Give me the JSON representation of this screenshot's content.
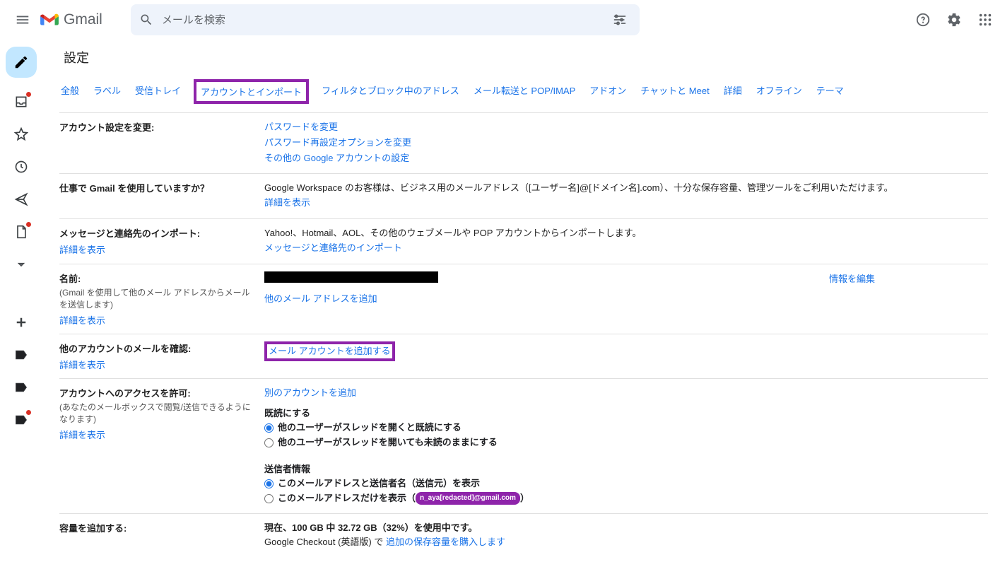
{
  "header": {
    "product": "Gmail",
    "search_placeholder": "メールを検索"
  },
  "page": {
    "title": "設定"
  },
  "tabs": [
    "全般",
    "ラベル",
    "受信トレイ",
    "アカウントとインポート",
    "フィルタとブロック中のアドレス",
    "メール転送と POP/IMAP",
    "アドオン",
    "チャットと Meet",
    "詳細",
    "オフライン",
    "テーマ"
  ],
  "sec_account": {
    "label": "アカウント設定を変更:",
    "links": [
      "パスワードを変更",
      "パスワード再設定オプションを変更",
      "その他の Google アカウントの設定"
    ]
  },
  "sec_workspace": {
    "label": "仕事で Gmail を使用していますか？",
    "text": "Google Workspace のお客様は、ビジネス用のメールアドレス（[ユーザー名]@[ドメイン名].com）、十分な保存容量、管理ツールをご利用いただけます。",
    "more": "詳細を表示"
  },
  "sec_import": {
    "label": "メッセージと連絡先のインポート:",
    "more": "詳細を表示",
    "text": "Yahoo!、Hotmail、AOL、その他のウェブメールや POP アカウントからインポートします。",
    "link": "メッセージと連絡先のインポート"
  },
  "sec_name": {
    "label": "名前:",
    "sub": "(Gmail を使用して他のメール アドレスからメールを送信します)",
    "more": "詳細を表示",
    "add": "他のメール アドレスを追加",
    "edit": "情報を編集"
  },
  "sec_check": {
    "label": "他のアカウントのメールを確認:",
    "more": "詳細を表示",
    "add": "メール アカウントを追加する"
  },
  "sec_access": {
    "label": "アカウントへのアクセスを許可:",
    "sub": "(あなたのメールボックスで閲覧/送信できるようになります)",
    "more": "詳細を表示",
    "add": "別のアカウントを追加",
    "grp1_title": "既読にする",
    "grp1_opt1": "他のユーザーがスレッドを開くと既読にする",
    "grp1_opt2": "他のユーザーがスレッドを開いても未読のままにする",
    "grp2_title": "送信者情報",
    "grp2_opt1": "このメールアドレスと送信者名（送信元）を表示",
    "grp2_opt2": "このメールアドレスだけを表示（",
    "grp2_opt2_redacted_pill": "n_aya[redacted]@gmail.com",
    "grp2_opt2_end": "）"
  },
  "sec_storage": {
    "label": "容量を追加する:",
    "line1": "現在、100 GB 中 32.72 GB（32%）を使用中です。",
    "line2a": "Google Checkout (英語版) で ",
    "line2b": "追加の保存容量を購入します"
  }
}
